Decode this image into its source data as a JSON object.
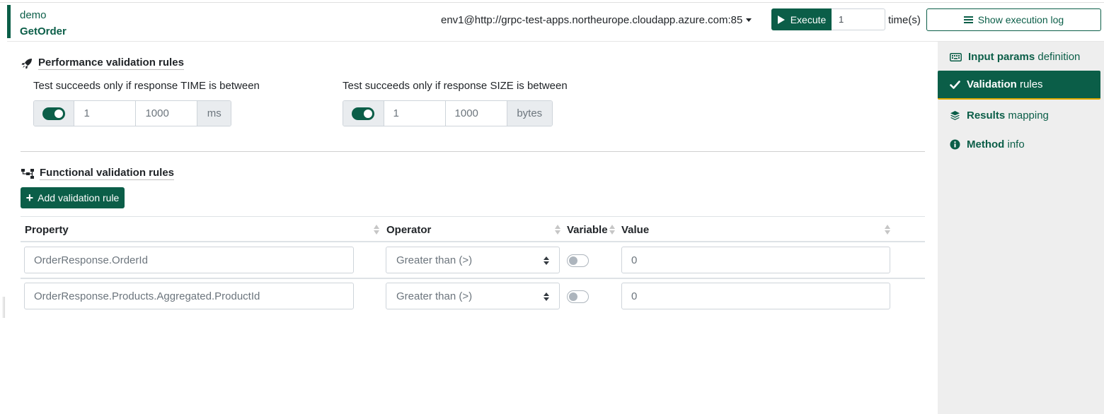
{
  "header": {
    "breadcrumb_parent": "demo",
    "method_name": "GetOrder",
    "environment": "env1@http://grpc-test-apps.northeurope.cloudapp.azure.com:85",
    "execute_label": "Execute",
    "execute_count": "1",
    "times_suffix": "time(s)",
    "show_log_label": "Show execution log"
  },
  "sidebar": {
    "items": [
      {
        "bold": "Input params",
        "rest": " definition",
        "icon": "keyboard-icon",
        "active": false
      },
      {
        "bold": "Validation",
        "rest": " rules",
        "icon": "check-icon",
        "active": true
      },
      {
        "bold": "Results",
        "rest": " mapping",
        "icon": "layers-icon",
        "active": false
      },
      {
        "bold": "Method",
        "rest": " info",
        "icon": "info-icon",
        "active": false
      }
    ]
  },
  "performance": {
    "title": "Performance validation rules",
    "time": {
      "label": "Test succeeds only if response TIME is between",
      "enabled": true,
      "min": "1",
      "max": "1000",
      "unit": "ms"
    },
    "size": {
      "label": "Test succeeds only if response SIZE is between",
      "enabled": true,
      "min": "1",
      "max": "1000",
      "unit": "bytes"
    }
  },
  "functional": {
    "title": "Functional validation rules",
    "add_label": "Add validation rule",
    "columns": [
      "Property",
      "Operator",
      "Variable",
      "Value"
    ],
    "rows": [
      {
        "property": "OrderResponse.OrderId",
        "operator": "Greater than (>)",
        "variable": false,
        "value": "0"
      },
      {
        "property": "OrderResponse.Products.Aggregated.ProductId",
        "operator": "Greater than (>)",
        "variable": false,
        "value": "0"
      }
    ]
  },
  "colors": {
    "accent": "#0b5e48",
    "active_underline": "#e0a800",
    "sidebar_bg": "#eeeeee"
  }
}
